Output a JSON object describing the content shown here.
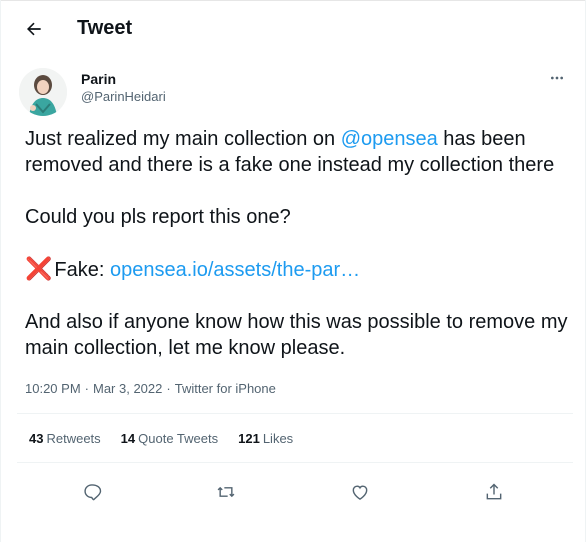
{
  "header": {
    "title": "Tweet",
    "back_icon": "arrow-left-icon"
  },
  "author": {
    "display_name": "Parin",
    "handle": "@ParinHeidari",
    "avatar_icon": "avatar-illustration"
  },
  "tweet": {
    "line1_prefix": "Just realized my main collection on ",
    "mention": "@opensea",
    "line1_suffix": " has been removed and there is a fake one instead my collection there",
    "line2": "Could you pls report this one?",
    "fake_emoji": "❌",
    "fake_label": "Fake: ",
    "fake_link": "opensea.io/assets/the-par…",
    "line4": "And also if anyone know how this was possible to remove my main collection, let me know please."
  },
  "meta": {
    "time": "10:20 PM",
    "date": "Mar 3, 2022",
    "source": "Twitter for iPhone",
    "separator": "·"
  },
  "stats": {
    "retweets_count": "43",
    "retweets_label": "Retweets",
    "quotes_count": "14",
    "quotes_label": "Quote Tweets",
    "likes_count": "121",
    "likes_label": "Likes"
  },
  "actions": [
    "reply-icon",
    "retweet-icon",
    "like-icon",
    "share-icon"
  ],
  "colors": {
    "link": "#1d9bf0",
    "secondary_text": "#536471",
    "primary_text": "#0f1419",
    "x_mark": "#e0142c"
  }
}
